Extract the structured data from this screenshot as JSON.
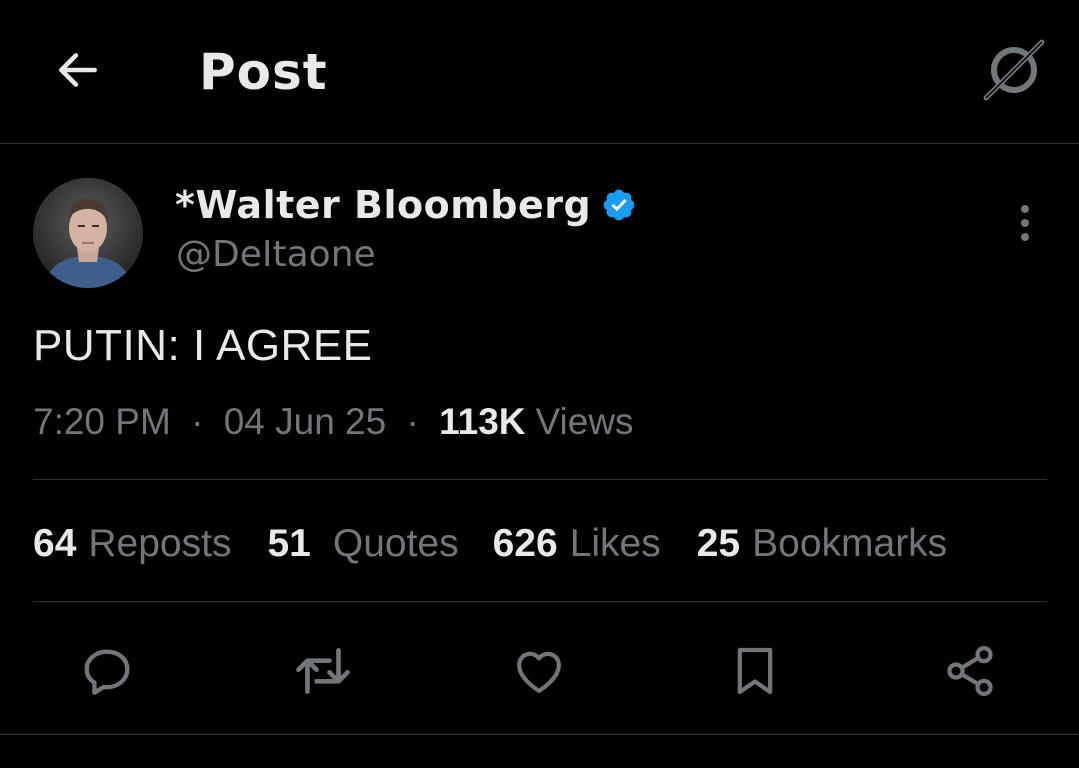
{
  "header": {
    "title": "Post",
    "back_icon": "arrow-left-icon",
    "grok_icon": "grok-icon"
  },
  "author": {
    "display_name": "*Walter Bloomberg",
    "handle": "@DeItaone",
    "verified_color": "#1d9bf0",
    "more_icon": "more-vertical-icon"
  },
  "post": {
    "text": "PUTIN: I AGREE",
    "time": "7:20 PM",
    "separator": "·",
    "date": "04 Jun 25",
    "views_count": "113K",
    "views_label": "Views"
  },
  "stats": [
    {
      "count": "64",
      "label": "Reposts"
    },
    {
      "count": "51",
      "label": "Quotes"
    },
    {
      "count": "626",
      "label": "Likes"
    },
    {
      "count": "25",
      "label": "Bookmarks"
    }
  ],
  "actions": [
    "reply-icon",
    "repost-icon",
    "like-icon",
    "bookmark-icon",
    "share-icon"
  ],
  "colors": {
    "background": "#000000",
    "text_primary": "#e7e9ea",
    "text_secondary": "#71767b",
    "border": "#2f3336",
    "accent": "#1d9bf0"
  }
}
